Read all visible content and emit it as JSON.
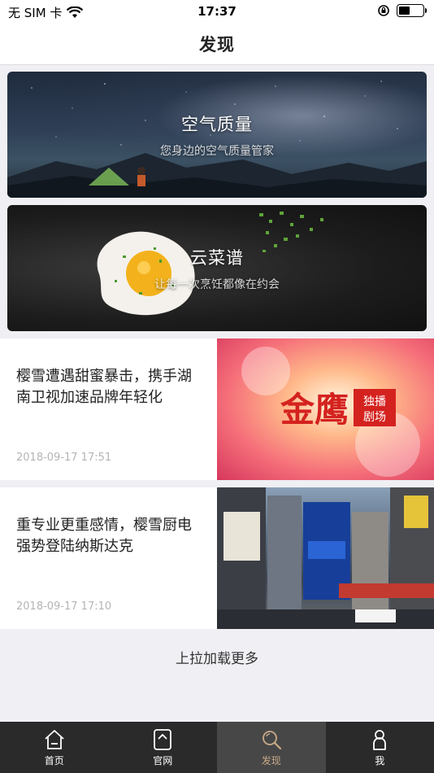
{
  "status_bar": {
    "carrier": "无 SIM 卡",
    "time": "17:37",
    "wifi_icon": "wifi-icon",
    "lock_icon": "orientation-lock-icon",
    "battery_level": 0.45
  },
  "nav": {
    "title": "发现"
  },
  "banners": [
    {
      "title": "空气质量",
      "subtitle": "您身边的空气质量管家"
    },
    {
      "title": "云菜谱",
      "subtitle": "让每一次烹饪都像在约会"
    }
  ],
  "news": [
    {
      "title": "樱雪遭遇甜蜜暴击，携手湖南卫视加速品牌年轻化",
      "date": "2018-09-17 17:51"
    },
    {
      "title": "重专业更重感情，樱雪厨电强势登陆纳斯达克",
      "date": "2018-09-17 17:10"
    }
  ],
  "load_more": "上拉加载更多",
  "tabs": [
    {
      "label": "首页",
      "icon": "home-icon"
    },
    {
      "label": "官网",
      "icon": "website-icon"
    },
    {
      "label": "发现",
      "icon": "search-icon",
      "active": true
    },
    {
      "label": "我",
      "icon": "person-icon"
    }
  ],
  "colors": {
    "tab_active": "#c9ab88",
    "tab_bar": "#2a2a2a",
    "tab_active_bg": "#474747"
  }
}
